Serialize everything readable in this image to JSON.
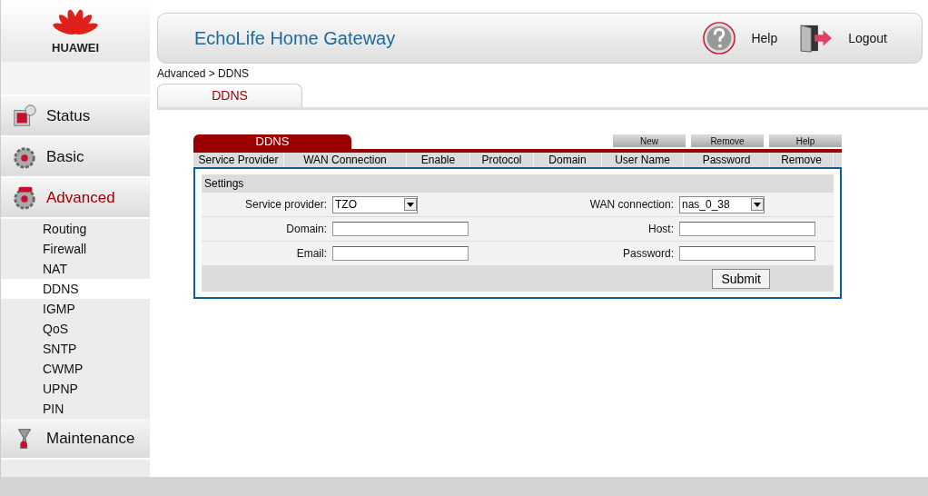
{
  "logo": {
    "text": "HUAWEI"
  },
  "header": {
    "title": "EchoLife Home Gateway",
    "help": "Help",
    "logout": "Logout"
  },
  "sidebar": {
    "items": [
      {
        "label": "Status",
        "selected": false
      },
      {
        "label": "Basic",
        "selected": false
      },
      {
        "label": "Advanced",
        "selected": true,
        "children": [
          {
            "label": "Routing",
            "selected": false
          },
          {
            "label": "Firewall",
            "selected": false
          },
          {
            "label": "NAT",
            "selected": false
          },
          {
            "label": "DDNS",
            "selected": true
          },
          {
            "label": "IGMP",
            "selected": false
          },
          {
            "label": "QoS",
            "selected": false
          },
          {
            "label": "SNTP",
            "selected": false
          },
          {
            "label": "CWMP",
            "selected": false
          },
          {
            "label": "UPNP",
            "selected": false
          },
          {
            "label": "PIN",
            "selected": false
          }
        ]
      },
      {
        "label": "Maintenance",
        "selected": false
      }
    ]
  },
  "breadcrumb": "Advanced > DDNS",
  "tabs": [
    {
      "label": "DDNS",
      "selected": true
    }
  ],
  "panel": {
    "title": "DDNS",
    "buttons": [
      "New",
      "Remove",
      "Help"
    ],
    "table": {
      "columns": [
        "Service Provider",
        "WAN Connection",
        "Enable",
        "Protocol",
        "Domain",
        "User Name",
        "Password",
        "Remove"
      ]
    },
    "settings": {
      "title": "Settings",
      "rows": [
        [
          {
            "label": "Service provider:",
            "kind": "select",
            "value": "TZO"
          },
          {
            "label": "WAN connection:",
            "kind": "select",
            "value": "nas_0_38"
          }
        ],
        [
          {
            "label": "Domain:",
            "kind": "text"
          },
          {
            "label": "Host:",
            "kind": "text"
          }
        ],
        [
          {
            "label": "Email:",
            "kind": "text"
          },
          {
            "label": "Password:",
            "kind": "text"
          }
        ]
      ],
      "submit": "Submit"
    }
  }
}
